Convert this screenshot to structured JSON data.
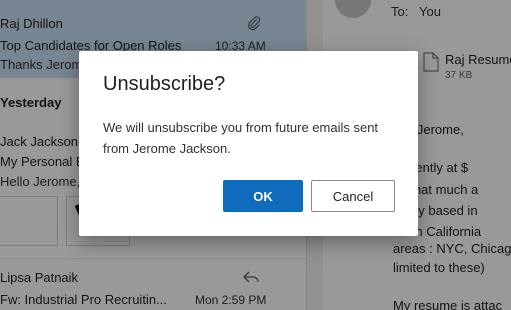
{
  "message_list": {
    "selected": {
      "sender": "Raj Dhillon",
      "subject": "Top Candidates for Open Roles",
      "time": "10:33 AM",
      "preview": "Thanks Jerome,",
      "icon": "paperclip-icon"
    },
    "group_header": "Yesterday",
    "second": {
      "sender": "Jack Jackson",
      "subject": "My Personal E",
      "preview": "Hello Jerome,"
    },
    "third": {
      "sender": "Lipsa Patnaik",
      "subject": "Fw: Industrial Pro Recruitin...",
      "time": "Mon 2:59 PM",
      "icon": "reply-icon"
    }
  },
  "reading_pane": {
    "to_label": "To:",
    "to_value": "You",
    "attachment": {
      "name": "Raj Resume",
      "size": "37 KB"
    },
    "body_lines": [
      "nks Jerome,",
      "currently at $",
      "ce that much a",
      "rently based in",
      "thern California",
      "areas : NYC, Chicag",
      "limited to these)",
      "My resume is attac"
    ]
  },
  "dialog": {
    "title": "Unsubscribe?",
    "message": "We will unsubscribe you from future emails sent from Jerome Jackson.",
    "ok_label": "OK",
    "cancel_label": "Cancel"
  },
  "colors": {
    "accent": "#0f6cbd",
    "selected_bg": "#c7e0f4",
    "overlay": "rgba(0,0,0,0.4)"
  }
}
